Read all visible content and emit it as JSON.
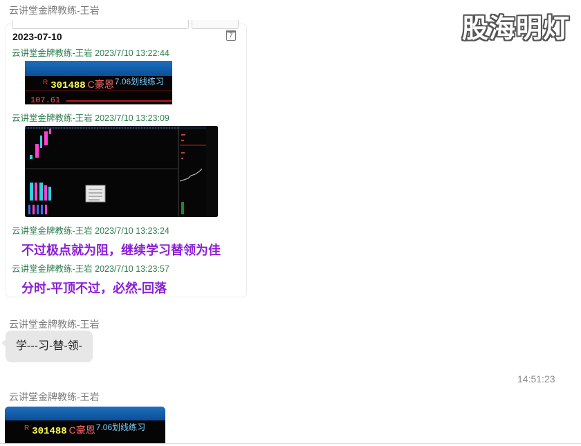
{
  "watermark": "股海明灯",
  "messages": [
    {
      "sender": "云讲堂金牌教练-王岩"
    },
    {
      "sender": "云讲堂金牌教练-王岩",
      "text": "学---习-替-领-"
    },
    {
      "sender": "云讲堂金牌教练-王岩",
      "time": "14:51:23"
    }
  ],
  "card": {
    "date": "2023-07-10",
    "calendar_day": "7",
    "entries": [
      {
        "meta": "云讲堂金牌教练-王岩 2023/7/10 13:22:44"
      },
      {
        "meta": "云讲堂金牌教练-王岩 2023/7/10 13:23:09"
      },
      {
        "meta": "云讲堂金牌教练-王岩 2023/7/10 13:23:24",
        "text": "不过极点就为阻，继续学习替领为佳"
      },
      {
        "meta": "云讲堂金牌教练-王岩 2023/7/10 13:23:57",
        "text": "分时-平顶不过，必然-回落"
      }
    ],
    "stock_snippet": {
      "marker": "R",
      "code": "301488",
      "name": "C豪恩",
      "note": "7.06划线练习",
      "price_fragment": "107.61"
    }
  },
  "bottom_snippet": {
    "marker": "R",
    "code": "301488",
    "name": "C豪恩",
    "note": "7.06划线练习"
  },
  "colors": {
    "meta_green": "#2e7d4f",
    "highlight_purple": "#8a1fd6",
    "bubble_gray": "#e7e7e7"
  }
}
